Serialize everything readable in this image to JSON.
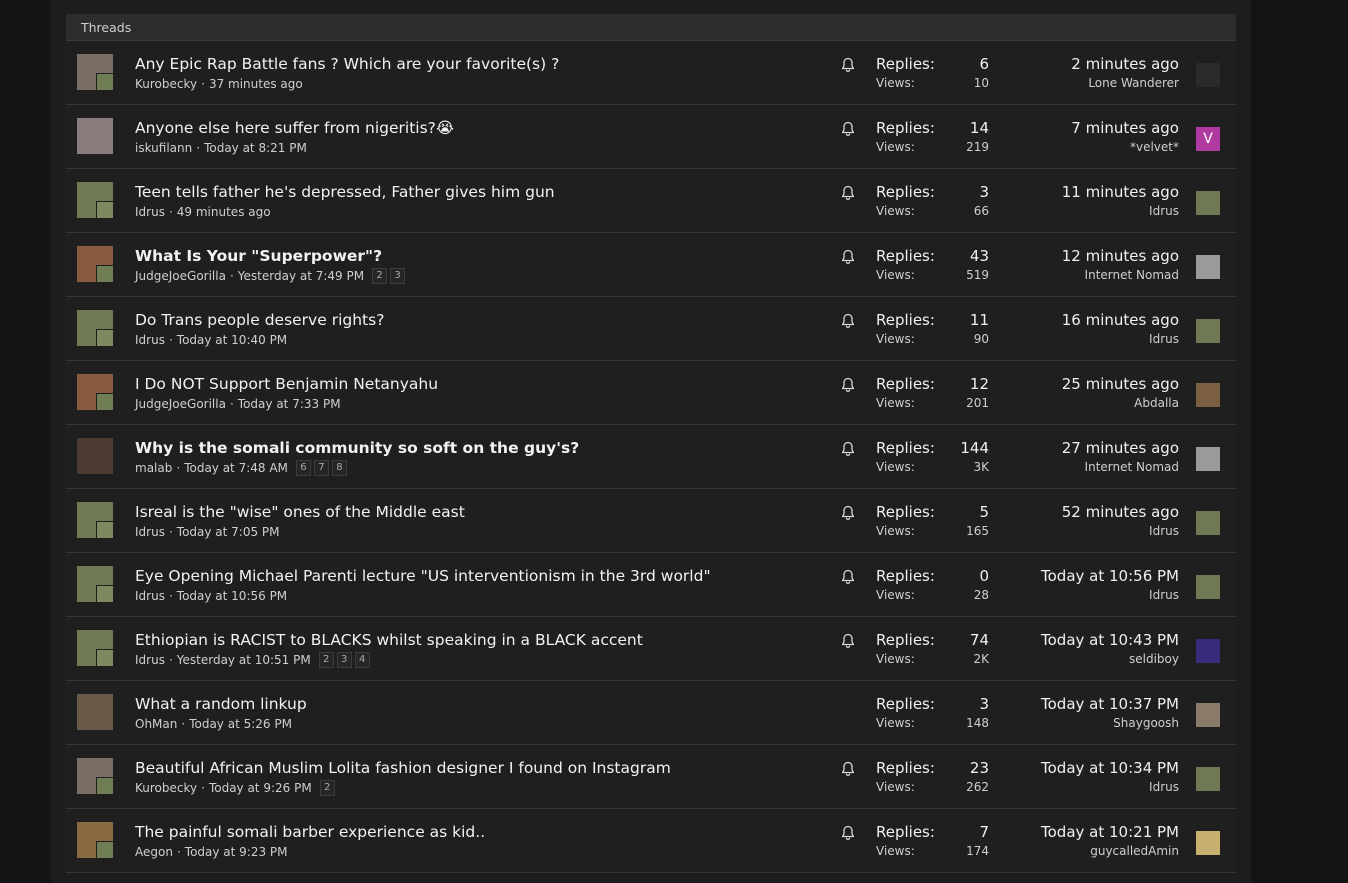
{
  "header": {
    "title": "Threads"
  },
  "labels": {
    "replies": "Replies:",
    "views": "Views:"
  },
  "threads": [
    {
      "title": "Any Epic Rap Battle fans ? Which are your favorite(s) ?",
      "bold": false,
      "author": "Kurobecky",
      "date": "37 minutes ago",
      "pages": [],
      "watched": true,
      "replies": "6",
      "views": "10",
      "last_time": "2 minutes ago",
      "last_user": "Lone Wanderer",
      "avatar_color": "#7a6e66",
      "mini_color": "#6f7d55",
      "last_color": "#2b2b2b",
      "last_letter": ""
    },
    {
      "title": "Anyone else here suffer from nigeritis?😭",
      "bold": false,
      "author": "iskufilann",
      "date": "Today at 8:21 PM",
      "pages": [],
      "watched": true,
      "replies": "14",
      "views": "219",
      "last_time": "7 minutes ago",
      "last_user": "*velvet*",
      "avatar_color": "#8a7c7c",
      "mini_color": "",
      "last_color": "#b03aa0",
      "last_letter": "V"
    },
    {
      "title": "Teen tells father he's depressed, Father gives him gun",
      "bold": false,
      "author": "Idrus",
      "date": "49 minutes ago",
      "pages": [],
      "watched": true,
      "replies": "3",
      "views": "66",
      "last_time": "11 minutes ago",
      "last_user": "Idrus",
      "avatar_color": "#6f7a55",
      "mini_color": "#7d8a5e",
      "last_color": "#6f7a55",
      "last_letter": ""
    },
    {
      "title": "What Is Your \"Superpower\"?",
      "bold": true,
      "author": "JudgeJoeGorilla",
      "date": "Yesterday at 7:49 PM",
      "pages": [
        "2",
        "3"
      ],
      "watched": true,
      "replies": "43",
      "views": "519",
      "last_time": "12 minutes ago",
      "last_user": "Internet Nomad",
      "avatar_color": "#8a5a40",
      "mini_color": "#6f7d55",
      "last_color": "#9a9a9a",
      "last_letter": ""
    },
    {
      "title": "Do Trans people deserve rights?",
      "bold": false,
      "author": "Idrus",
      "date": "Today at 10:40 PM",
      "pages": [],
      "watched": true,
      "replies": "11",
      "views": "90",
      "last_time": "16 minutes ago",
      "last_user": "Idrus",
      "avatar_color": "#6f7a55",
      "mini_color": "#7d8a5e",
      "last_color": "#6f7a55",
      "last_letter": ""
    },
    {
      "title": "I Do NOT Support Benjamin Netanyahu",
      "bold": false,
      "author": "JudgeJoeGorilla",
      "date": "Today at 7:33 PM",
      "pages": [],
      "watched": true,
      "replies": "12",
      "views": "201",
      "last_time": "25 minutes ago",
      "last_user": "Abdalla",
      "avatar_color": "#8a5a40",
      "mini_color": "#6f7d55",
      "last_color": "#7a6040",
      "last_letter": ""
    },
    {
      "title": "Why is the somali community so soft on the guy's?",
      "bold": true,
      "author": "malab",
      "date": "Today at 7:48 AM",
      "pages": [
        "6",
        "7",
        "8"
      ],
      "watched": true,
      "replies": "144",
      "views": "3K",
      "last_time": "27 minutes ago",
      "last_user": "Internet Nomad",
      "avatar_color": "#4a3a30",
      "mini_color": "",
      "last_color": "#9a9a9a",
      "last_letter": ""
    },
    {
      "title": "Isreal is the \"wise\" ones of the Middle east",
      "bold": false,
      "author": "Idrus",
      "date": "Today at 7:05 PM",
      "pages": [],
      "watched": true,
      "replies": "5",
      "views": "165",
      "last_time": "52 minutes ago",
      "last_user": "Idrus",
      "avatar_color": "#6f7a55",
      "mini_color": "#7d8a5e",
      "last_color": "#6f7a55",
      "last_letter": ""
    },
    {
      "title": "Eye Opening Michael Parenti lecture \"US interventionism in the 3rd world\"",
      "bold": false,
      "author": "Idrus",
      "date": "Today at 10:56 PM",
      "pages": [],
      "watched": true,
      "replies": "0",
      "views": "28",
      "last_time": "Today at 10:56 PM",
      "last_user": "Idrus",
      "avatar_color": "#6f7a55",
      "mini_color": "#7d8a5e",
      "last_color": "#6f7a55",
      "last_letter": ""
    },
    {
      "title": "Ethiopian is RACIST to BLACKS whilst speaking in a BLACK accent",
      "bold": false,
      "author": "Idrus",
      "date": "Yesterday at 10:51 PM",
      "pages": [
        "2",
        "3",
        "4"
      ],
      "watched": true,
      "replies": "74",
      "views": "2K",
      "last_time": "Today at 10:43 PM",
      "last_user": "seldiboy",
      "avatar_color": "#6f7a55",
      "mini_color": "#7d8a5e",
      "last_color": "#3a2a7a",
      "last_letter": ""
    },
    {
      "title": "What a random linkup",
      "bold": false,
      "author": "OhMan",
      "date": "Today at 5:26 PM",
      "pages": [],
      "watched": false,
      "replies": "3",
      "views": "148",
      "last_time": "Today at 10:37 PM",
      "last_user": "Shaygoosh",
      "avatar_color": "#6a5a4a",
      "mini_color": "",
      "last_color": "#8a7a6a",
      "last_letter": ""
    },
    {
      "title": "Beautiful African Muslim Lolita fashion designer I found on Instagram",
      "bold": false,
      "author": "Kurobecky",
      "date": "Today at 9:26 PM",
      "pages": [
        "2"
      ],
      "watched": true,
      "replies": "23",
      "views": "262",
      "last_time": "Today at 10:34 PM",
      "last_user": "Idrus",
      "avatar_color": "#7a6e66",
      "mini_color": "#6f7d55",
      "last_color": "#6f7a55",
      "last_letter": ""
    },
    {
      "title": "The painful somali barber experience as kid..",
      "bold": false,
      "author": "Aegon",
      "date": "Today at 9:23 PM",
      "pages": [],
      "watched": true,
      "replies": "7",
      "views": "174",
      "last_time": "Today at 10:21 PM",
      "last_user": "guycalledAmin",
      "avatar_color": "#8a6a40",
      "mini_color": "#6f7d55",
      "last_color": "#c8b070",
      "last_letter": ""
    }
  ]
}
